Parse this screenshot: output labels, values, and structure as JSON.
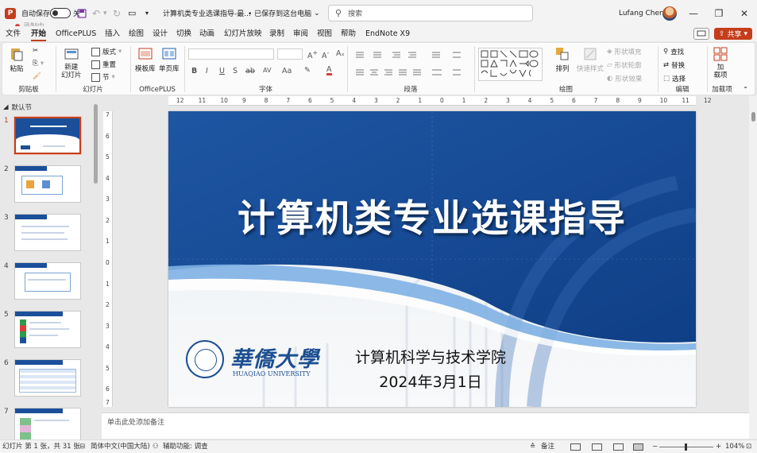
{
  "titlebar": {
    "autosave_label": "自动保存",
    "autosave_state": "关",
    "doc_title": "计算机类专业选课指导-最...",
    "save_status": "• 已保存到这台电脑",
    "search_placeholder": "搜索",
    "user_name": "Lufang Chen"
  },
  "recording": {
    "label": "录制中"
  },
  "menu": {
    "tabs": [
      "文件",
      "开始",
      "OfficePLUS",
      "插入",
      "绘图",
      "设计",
      "切换",
      "动画",
      "幻灯片放映",
      "录制",
      "审阅",
      "视图",
      "帮助",
      "EndNote X9"
    ],
    "active_tab": "开始",
    "share_label": "共享"
  },
  "ribbon": {
    "clipboard": {
      "paste": "粘贴",
      "label": "剪贴板"
    },
    "slides": {
      "new_slide": "新建\n幻灯片",
      "layout": "版式",
      "reset": "重置",
      "section": "节",
      "label": "幻灯片"
    },
    "officeplus": {
      "templates": "模板库",
      "single_page": "单页库",
      "label": "OfficePLUS"
    },
    "font": {
      "label": "字体",
      "bold": "B",
      "italic": "I",
      "underline": "U",
      "strike": "S",
      "spacing": "AV",
      "case": "Aa",
      "color_a": "A"
    },
    "paragraph": {
      "label": "段落"
    },
    "drawing": {
      "arrange": "排列",
      "quick_styles": "快速样式",
      "fill": "形状填充",
      "outline": "形状轮廓",
      "effects": "形状效果",
      "label": "绘图"
    },
    "editing": {
      "find": "查找",
      "replace": "替换",
      "select": "选择",
      "label": "编辑"
    },
    "addins": {
      "addins": "加\n载项",
      "label": "加载项"
    }
  },
  "thumbnails": {
    "section": "默认节",
    "slides": [
      1,
      2,
      3,
      4,
      5,
      6,
      7
    ],
    "selected": 1
  },
  "slide": {
    "title": "计算机类专业选课指导",
    "department": "计算机科学与技术学院",
    "date": "2024年3月1日",
    "logo_cn": "華僑大學",
    "logo_en": "HUAQIAO UNIVERSITY"
  },
  "ruler": {
    "h_ticks": [
      "12",
      "11",
      "10",
      "9",
      "8",
      "7",
      "6",
      "5",
      "4",
      "3",
      "2",
      "1",
      "0",
      "1",
      "2",
      "3",
      "4",
      "5",
      "6",
      "7",
      "8",
      "9",
      "10",
      "11",
      "12"
    ],
    "v_ticks": [
      "7",
      "6",
      "5",
      "4",
      "3",
      "2",
      "1",
      "0",
      "1",
      "2",
      "3",
      "4",
      "5",
      "6",
      "7"
    ]
  },
  "notes": {
    "placeholder": "单击此处添加备注"
  },
  "status": {
    "slide_info": "幻灯片 第 1 张，共 31 张",
    "language": "简体中文(中国大陆)",
    "accessibility": "辅助功能: 调查",
    "notes_btn": "备注",
    "zoom": "104%"
  },
  "colors": {
    "accent": "#c43e1c",
    "slide_blue": "#1b4f9a",
    "logo_blue": "#1d4f91"
  }
}
